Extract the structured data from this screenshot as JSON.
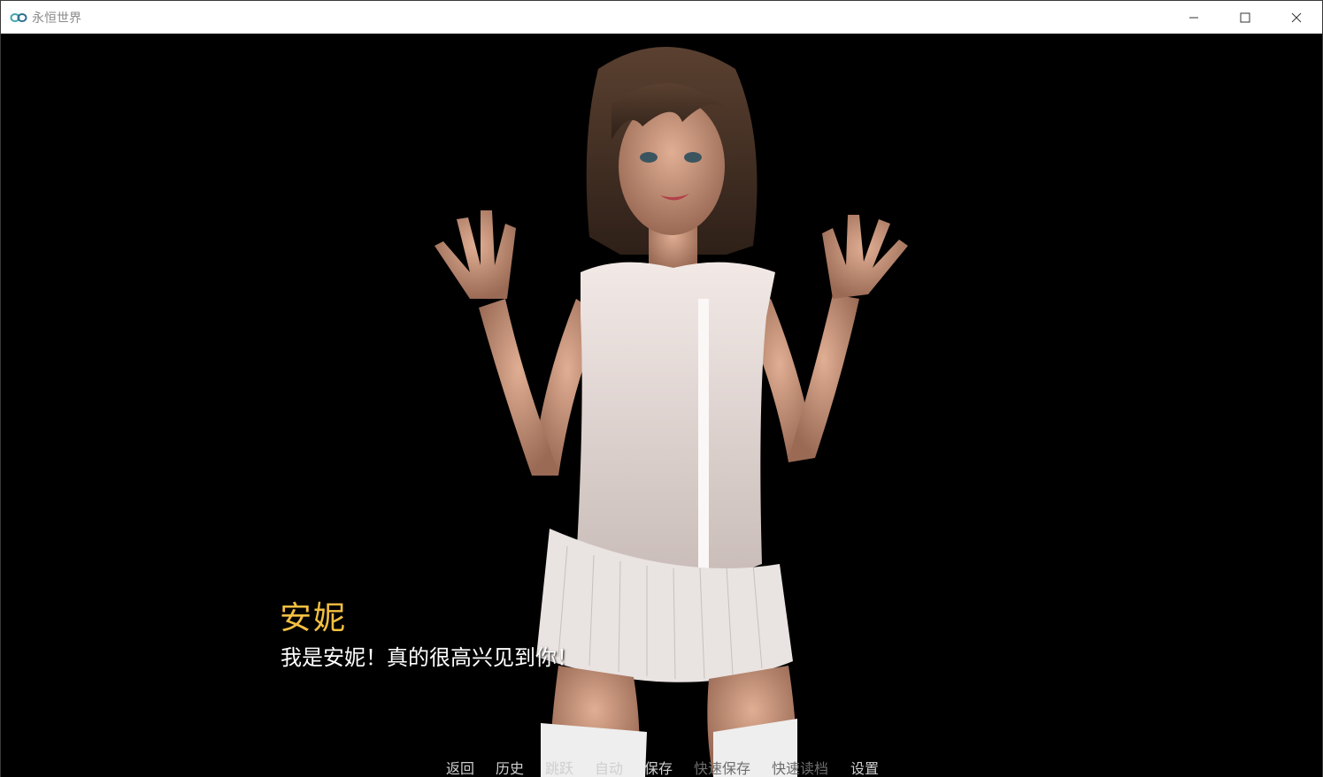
{
  "window": {
    "title": "永恒世界"
  },
  "dialogue": {
    "speaker": "安妮",
    "text": "我是安妮！真的很高兴见到你！"
  },
  "quick_menu": {
    "back": "返回",
    "history": "历史",
    "skip": "跳跃",
    "auto": "自动",
    "save": "保存",
    "quick_save": "快速保存",
    "quick_load": "快速读档",
    "preferences": "设置"
  },
  "colors": {
    "speaker": "#f4c042",
    "dialogue_text": "#ffffff",
    "menu_text": "#cfcfcf",
    "menu_text_disabled": "#6e6e6e",
    "background": "#000000"
  }
}
